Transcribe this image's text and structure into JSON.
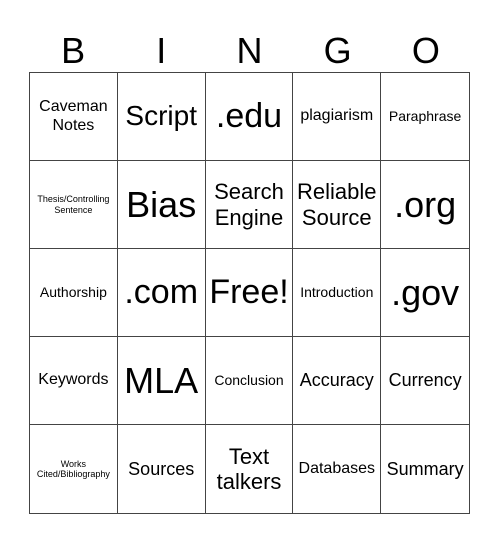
{
  "header": [
    "B",
    "I",
    "N",
    "G",
    "O"
  ],
  "cells": [
    [
      "Caveman Notes",
      "Script",
      ".edu",
      "plagiarism",
      "Paraphrase"
    ],
    [
      "Thesis/Controlling Sentence",
      "Bias",
      "Search Engine",
      "Reliable Source",
      ".org"
    ],
    [
      "Authorship",
      ".com",
      "Free!",
      "Introduction",
      ".gov"
    ],
    [
      "Keywords",
      "MLA",
      "Conclusion",
      "Accuracy",
      "Currency"
    ],
    [
      "Works Cited/Bibliography",
      "Sources",
      "Text talkers",
      "Databases",
      "Summary"
    ]
  ]
}
